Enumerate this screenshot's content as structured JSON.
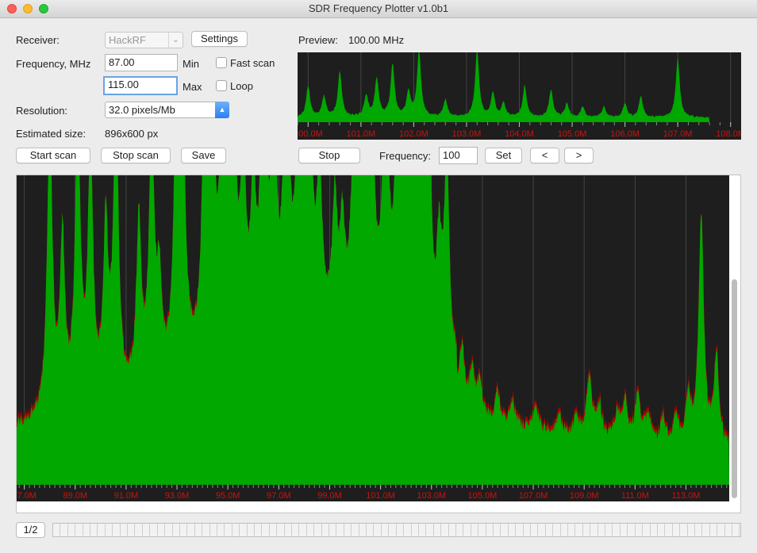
{
  "window": {
    "title": "SDR Frequency Plotter v1.0b1"
  },
  "receiver": {
    "label": "Receiver:",
    "value": "HackRF",
    "settings_label": "Settings"
  },
  "frequency": {
    "label": "Frequency, MHz",
    "min_value": "87.00",
    "min_label": "Min",
    "max_value": "115.00",
    "max_label": "Max"
  },
  "options": {
    "fast_scan_label": "Fast scan",
    "loop_label": "Loop"
  },
  "resolution": {
    "label": "Resolution:",
    "value": "32.0 pixels/Mb"
  },
  "estimated": {
    "label": "Estimated size:",
    "value": "896x600 px"
  },
  "buttons": {
    "start": "Start scan",
    "stop": "Stop scan",
    "save": "Save"
  },
  "preview": {
    "label": "Preview:",
    "value": "100.00 MHz",
    "stop_label": "Stop",
    "freq_label": "Frequency:",
    "freq_value": "100",
    "set_label": "Set",
    "prev_label": "<",
    "next_label": ">"
  },
  "pager": {
    "label": "1/2"
  },
  "colors": {
    "signal": "#00a800",
    "peak": "#b00000",
    "background": "#1e1e1e",
    "axis_text": "#d01010",
    "accent": "#2b7ef3"
  },
  "chart_data": [
    {
      "type": "area",
      "name": "preview",
      "x_unit": "MHz",
      "xlim": [
        99.8,
        108.2
      ],
      "tick_labels": [
        "100.0M",
        "101.0M",
        "102.0M",
        "103.0M",
        "104.0M",
        "105.0M",
        "106.0M",
        "107.0M",
        "108.0M"
      ],
      "ticks": [
        100,
        101,
        102,
        103,
        104,
        105,
        106,
        107,
        108
      ],
      "signal_end": 107.6,
      "peaks": [
        [
          100.0,
          0.45
        ],
        [
          100.3,
          0.3
        ],
        [
          100.6,
          0.65
        ],
        [
          101.1,
          0.3
        ],
        [
          101.3,
          0.55
        ],
        [
          101.6,
          0.75
        ],
        [
          101.9,
          0.35
        ],
        [
          102.1,
          0.95
        ],
        [
          102.6,
          0.25
        ],
        [
          103.2,
          0.95
        ],
        [
          103.5,
          0.35
        ],
        [
          103.7,
          0.2
        ],
        [
          104.1,
          0.45
        ],
        [
          104.6,
          0.4
        ],
        [
          104.9,
          0.2
        ],
        [
          105.2,
          0.15
        ],
        [
          105.6,
          0.15
        ],
        [
          106.0,
          0.2
        ],
        [
          106.3,
          0.3
        ],
        [
          107.0,
          0.85
        ]
      ]
    },
    {
      "type": "area",
      "name": "scan",
      "x_unit": "MHz",
      "xlim": [
        86.7,
        114.7
      ],
      "tick_labels": [
        "87.0M",
        "89.0M",
        "91.0M",
        "93.0M",
        "95.0M",
        "97.0M",
        "99.0M",
        "101.0M",
        "103.0M",
        "105.0M",
        "107.0M",
        "109.0M",
        "111.0M",
        "113.0M"
      ],
      "ticks": [
        87,
        89,
        91,
        93,
        95,
        97,
        99,
        101,
        103,
        105,
        107,
        109,
        111,
        113
      ],
      "peaks": [
        [
          88.0,
          1.0
        ],
        [
          88.5,
          0.55
        ],
        [
          89.1,
          1.0
        ],
        [
          89.6,
          0.85
        ],
        [
          90.2,
          0.55
        ],
        [
          90.6,
          1.0
        ],
        [
          91.5,
          0.55
        ],
        [
          92.0,
          0.85
        ],
        [
          92.3,
          0.3
        ],
        [
          93.0,
          1.0
        ],
        [
          93.2,
          1.0
        ],
        [
          94.1,
          1.0
        ],
        [
          94.4,
          0.7
        ],
        [
          94.8,
          1.0
        ],
        [
          95.2,
          1.0
        ],
        [
          95.6,
          0.6
        ],
        [
          96.0,
          0.45
        ],
        [
          96.4,
          1.0
        ],
        [
          96.8,
          0.75
        ],
        [
          97.3,
          1.0
        ],
        [
          97.8,
          1.0
        ],
        [
          98.2,
          0.85
        ],
        [
          98.6,
          0.5
        ],
        [
          99.2,
          0.4
        ],
        [
          99.5,
          0.3
        ],
        [
          100.0,
          1.0
        ],
        [
          100.4,
          1.0
        ],
        [
          100.6,
          1.0
        ],
        [
          101.2,
          1.0
        ],
        [
          101.7,
          1.0
        ],
        [
          102.0,
          0.75
        ],
        [
          102.3,
          0.7
        ],
        [
          102.6,
          1.0
        ],
        [
          102.9,
          0.7
        ],
        [
          103.3,
          0.35
        ],
        [
          103.6,
          0.7
        ],
        [
          104.2,
          0.2
        ],
        [
          104.6,
          0.15
        ],
        [
          104.9,
          0.12
        ],
        [
          105.6,
          0.1
        ],
        [
          106.2,
          0.08
        ],
        [
          107.1,
          0.08
        ],
        [
          108.0,
          0.06
        ],
        [
          108.7,
          0.06
        ],
        [
          109.2,
          0.2
        ],
        [
          109.6,
          0.1
        ],
        [
          110.3,
          0.08
        ],
        [
          110.6,
          0.12
        ],
        [
          111.1,
          0.15
        ],
        [
          111.5,
          0.08
        ],
        [
          112.1,
          0.08
        ],
        [
          112.6,
          0.08
        ],
        [
          113.1,
          0.15
        ],
        [
          113.6,
          0.75
        ],
        [
          114.2,
          0.3
        ]
      ]
    }
  ]
}
